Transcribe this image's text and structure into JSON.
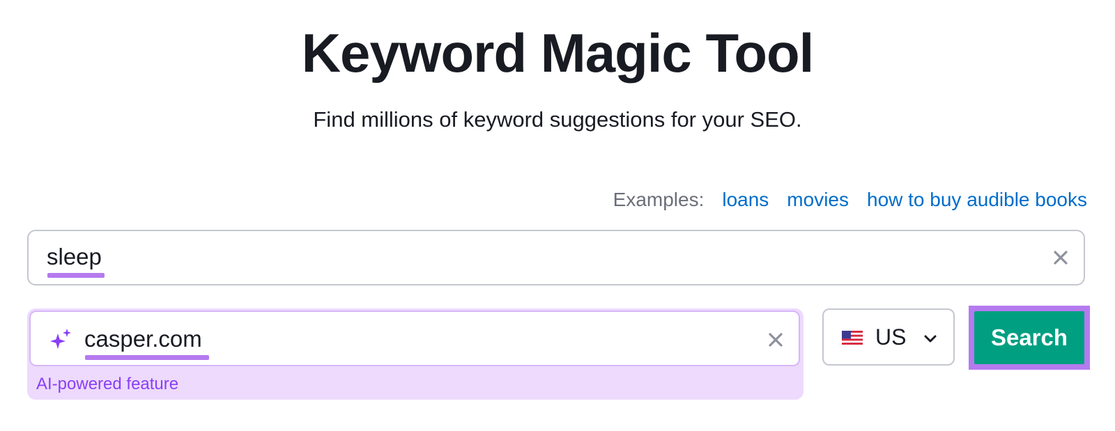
{
  "header": {
    "title": "Keyword Magic Tool",
    "subtitle": "Find millions of keyword suggestions for your SEO."
  },
  "examples": {
    "label": "Examples:",
    "links": [
      "loans",
      "movies",
      "how to buy audible books"
    ]
  },
  "keyword_input": {
    "value": "sleep",
    "clear_icon": "close-icon"
  },
  "domain_input": {
    "value": "casper.com",
    "icon": "sparkle-icon",
    "clear_icon": "close-icon",
    "feature_label": "AI-powered feature"
  },
  "country_select": {
    "selected": "US",
    "flag_icon": "us-flag-icon",
    "dropdown_icon": "chevron-down-icon"
  },
  "search_button": {
    "label": "Search"
  },
  "colors": {
    "accent_purple": "#b57aef",
    "ai_panel_bg": "#eddafd",
    "ai_label": "#8a3ff5",
    "link_blue": "#006dca",
    "search_green": "#009f81",
    "title_text": "#191b23"
  }
}
